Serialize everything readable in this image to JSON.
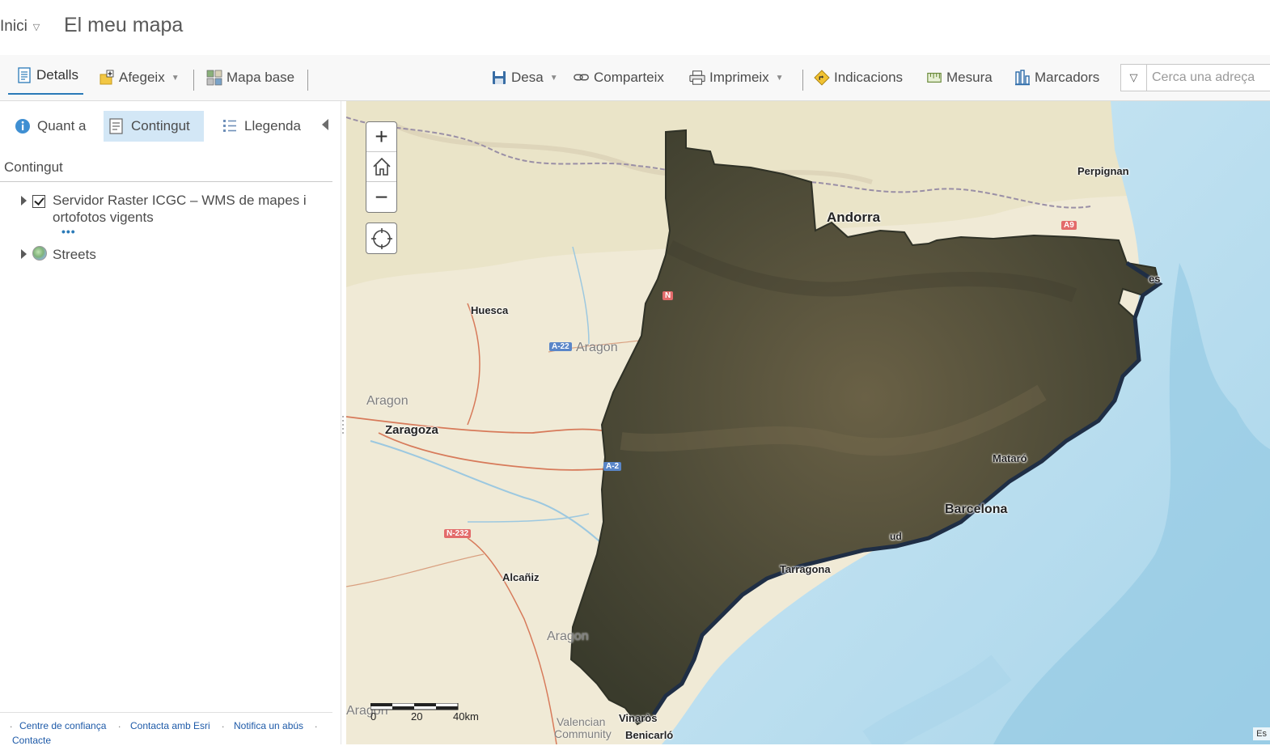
{
  "header": {
    "home_label": "Inici",
    "map_title": "El meu mapa"
  },
  "toolbar": {
    "details": "Detalls",
    "add": "Afegeix",
    "basemap": "Mapa base",
    "save": "Desa",
    "share": "Comparteix",
    "print": "Imprimeix",
    "directions": "Indicacions",
    "measure": "Mesura",
    "bookmarks": "Marcadors",
    "search_placeholder": "Cerca una adreça"
  },
  "panel": {
    "tabs": {
      "about": "Quant a",
      "content": "Contingut",
      "legend": "Llegenda"
    },
    "section_title": "Contingut",
    "layers": [
      {
        "name": "Servidor Raster ICGC – WMS de mapes i ortofotos vigents",
        "line1": "Servidor Raster ICGC – WMS de mapes i",
        "line2": "ortofotos vigents",
        "checked": true
      },
      {
        "name": "Streets"
      }
    ],
    "more_dots": "•••",
    "footer_links": [
      "Centre de confiança",
      "Contacta amb Esri",
      "Notifica un abús",
      "Contacte"
    ]
  },
  "map": {
    "labels": {
      "andorra": "Andorra",
      "perpignan": "Perpignan",
      "huesca": "Huesca",
      "aragon1": "Aragon",
      "aragon2": "Aragon",
      "aragon3": "Aragon",
      "aragon4": "Aragon",
      "zaragoza": "Zaragoza",
      "barcelona": "Barcelona",
      "tarragona": "Tarragona",
      "alcaniz": "Alcañiz",
      "valencian": "Valencian",
      "community": "Community",
      "vinaros": "Vinaròs",
      "benicarlo": "Benicarló",
      "mataro": "Mataró",
      "es": "es",
      "reus": "ud"
    },
    "roads": {
      "a22": "A-22",
      "a2": "A-2",
      "n232": "N-232",
      "a9": "A9",
      "n": "N"
    },
    "scale": [
      "0",
      "20",
      "40km"
    ],
    "attribution": "Es"
  },
  "colors": {
    "accent": "#2a7ab8",
    "active_tab_bg": "#d3e7f6",
    "sea": "#b6dced",
    "land": "#f0ead6",
    "imagery": "#4d4a38"
  }
}
